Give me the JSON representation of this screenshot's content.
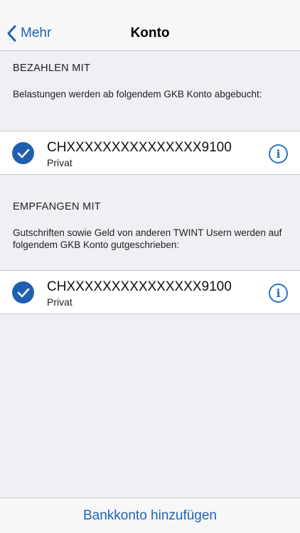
{
  "navbar": {
    "back_label": "Mehr",
    "title": "Konto"
  },
  "pay_section": {
    "header": "BEZAHLEN MIT",
    "description": "Belastungen werden ab folgendem GKB Konto abgebucht:",
    "account": {
      "number": "CHXXXXXXXXXXXXXXX9100",
      "type": "Privat",
      "selected": true
    }
  },
  "receive_section": {
    "header": "EMPFANGEN MIT",
    "description": "Gutschriften sowie Geld von anderen TWINT Usern werden auf folgendem GKB Konto gutgeschrieben:",
    "account": {
      "number": "CHXXXXXXXXXXXXXXX9100",
      "type": "Privat",
      "selected": true
    }
  },
  "bottom": {
    "add_account_label": "Bankkonto hinzufügen"
  },
  "colors": {
    "accent": "#1f63b6",
    "check": "#1f5fb0",
    "background": "#efeff4"
  }
}
